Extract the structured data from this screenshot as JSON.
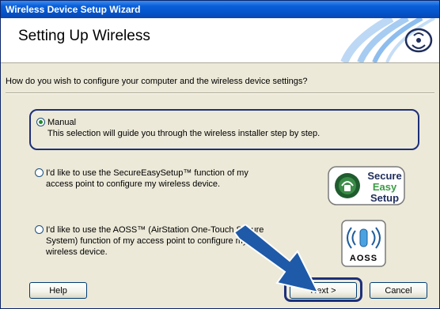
{
  "window": {
    "title": "Wireless Device Setup Wizard"
  },
  "header": {
    "heading": "Setting Up Wireless"
  },
  "question": "How do you wish to configure your computer and the wireless device settings?",
  "options": [
    {
      "label": "Manual",
      "description": "This selection will guide you through the wireless installer step by step.",
      "checked": true
    },
    {
      "line1": "I'd like to use the SecureEasySetup™ function of my",
      "line2": "access point to configure my wireless device.",
      "checked": false
    },
    {
      "line1": "I'd like to use the AOSS™ (AirStation One-Touch Secure",
      "line2": "System) function of my access point to configure my",
      "line3": "wireless device.",
      "checked": false
    }
  ],
  "logos": {
    "secure_easy_setup": {
      "word1": "Secure",
      "word2": "Easy",
      "word3": "Setup"
    },
    "aoss": {
      "text": "AOSS",
      "symbol": "((•))"
    }
  },
  "buttons": {
    "help": "Help",
    "next": "Next >",
    "cancel": "Cancel"
  },
  "colors": {
    "titlebar": "#0453c9",
    "highlight": "#1d2f7a",
    "arrow": "#1e5aa8"
  }
}
